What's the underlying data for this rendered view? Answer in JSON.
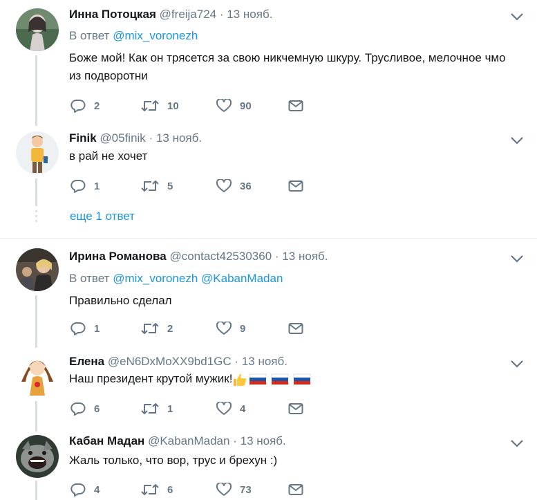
{
  "tweets": [
    {
      "name": "Инна Потоцкая",
      "handle": "@freija724",
      "time": "13 нояб.",
      "reply_prefix": "В ответ",
      "reply_to": [
        "@mix_voronezh"
      ],
      "text": "Боже мой! Как он трясется за свою никчемную шкуру. Трусливое, мелочное чмо из подворотни",
      "replies": "2",
      "retweets": "10",
      "likes": "90"
    },
    {
      "name": "Finik",
      "handle": "@05finik",
      "time": "13 нояб.",
      "text": "в рай не хочет",
      "replies": "1",
      "retweets": "5",
      "likes": "36"
    },
    {
      "name": "Ирина Романова",
      "handle": "@contact42530360",
      "time": "13 нояб.",
      "reply_prefix": "В ответ",
      "reply_to": [
        "@mix_voronezh",
        "@KabanMadan"
      ],
      "text": "Правильно сделал",
      "replies": "1",
      "retweets": "2",
      "likes": "9"
    },
    {
      "name": "Елена",
      "handle": "@eN6DxMoXX9bd1GC",
      "time": "13 нояб.",
      "text": "Наш президент крутой мужик!",
      "replies": "6",
      "retweets": "1",
      "likes": "4"
    },
    {
      "name": "Кабан Мадан",
      "handle": "@KabanMadan",
      "time": "13 нояб.",
      "text": "Жаль только, что вор, трус и брехун :)",
      "replies": "4",
      "retweets": "6",
      "likes": "73"
    }
  ],
  "more_replies": "еще 1 ответ",
  "separator": "·",
  "icons": [
    "reply-icon",
    "retweet-icon",
    "like-icon",
    "message-icon",
    "chevron-down-icon",
    "thumbs-up-emoji",
    "russia-flag-emoji"
  ],
  "colors": {
    "link": "#1b95e0",
    "muted": "#657786",
    "thread_line": "#d6dde3",
    "divider": "#e6ecf0"
  }
}
